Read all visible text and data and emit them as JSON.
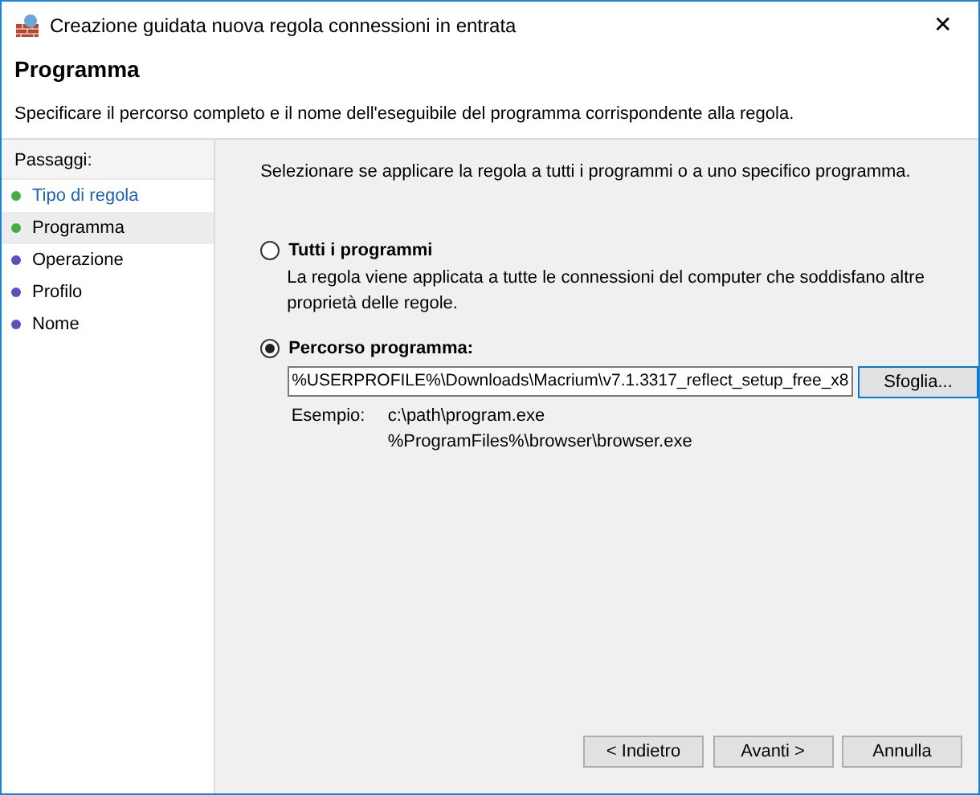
{
  "window": {
    "title": "Creazione guidata nuova regola connessioni in entrata",
    "close": "✕"
  },
  "header": {
    "title": "Programma",
    "description": "Specificare il percorso completo e il nome dell'eseguibile del programma corrispondente alla regola."
  },
  "steps": {
    "heading": "Passaggi:",
    "items": [
      {
        "label": "Tipo di regola",
        "selected": false,
        "link": true,
        "color": "#3cb043"
      },
      {
        "label": "Programma",
        "selected": true,
        "link": false,
        "color": "#3cb043"
      },
      {
        "label": "Operazione",
        "selected": false,
        "link": false,
        "color": "#5a4fc4"
      },
      {
        "label": "Profilo",
        "selected": false,
        "link": false,
        "color": "#5a4fc4"
      },
      {
        "label": "Nome",
        "selected": false,
        "link": false,
        "color": "#5a4fc4"
      }
    ]
  },
  "content": {
    "prompt": "Selezionare se applicare la regola a tutti i programmi o a uno specifico programma.",
    "options": [
      {
        "label": "Tutti i programmi",
        "selected": false,
        "description": "La regola viene applicata a tutte le connessioni del computer che soddisfano altre proprietà delle regole."
      },
      {
        "label": "Percorso programma:",
        "selected": true,
        "path_value": "%USERPROFILE%\\Downloads\\Macrium\\v7.1.3317_reflect_setup_free_x8",
        "browse": "Sfoglia...",
        "example_label": "Esempio:",
        "examples": [
          "c:\\path\\program.exe",
          "%ProgramFiles%\\browser\\browser.exe"
        ]
      }
    ]
  },
  "buttons": [
    "< Indietro",
    "Avanti >",
    "Annulla"
  ]
}
